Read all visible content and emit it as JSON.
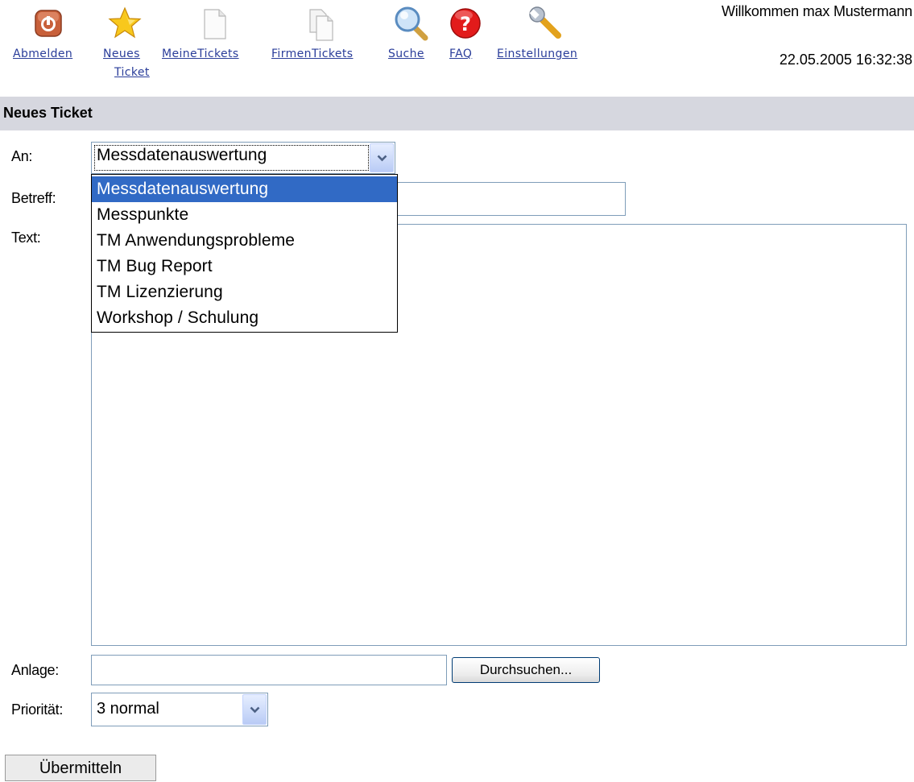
{
  "nav": {
    "items": [
      {
        "label": "Abmelden",
        "icon": "power-icon"
      },
      {
        "label_line1": "Neues",
        "label_line2": "Ticket",
        "icon": "star-icon"
      },
      {
        "label": "MeineTickets",
        "icon": "document-icon"
      },
      {
        "label": "FirmenTickets",
        "icon": "documents-icon"
      },
      {
        "label": "Suche",
        "icon": "magnifier-icon"
      },
      {
        "label": "FAQ",
        "icon": "help-icon"
      },
      {
        "label": "Einstellungen",
        "icon": "wrench-icon"
      }
    ]
  },
  "header": {
    "welcome": "Willkommen max Mustermann",
    "datetime": "22.05.2005 16:32:38"
  },
  "section": {
    "title": "Neues Ticket"
  },
  "form": {
    "an_label": "An:",
    "an_value": "Messdatenauswertung",
    "an_options": [
      "Messdatenauswertung",
      "Messpunkte",
      "TM Anwendungsprobleme",
      "TM Bug Report",
      "TM Lizenzierung",
      "Workshop / Schulung"
    ],
    "betreff_label": "Betreff:",
    "betreff_value": "",
    "text_label": "Text:",
    "text_value": "",
    "anlage_label": "Anlage:",
    "anlage_value": "",
    "browse_button": "Durchsuchen...",
    "prioritaet_label": "Priorität:",
    "prioritaet_value": "3 normal",
    "submit_button": "Übermitteln"
  },
  "colors": {
    "link": "#2a3d9a",
    "section_bg": "#d6d7df",
    "selected_option": "#316ac5"
  }
}
